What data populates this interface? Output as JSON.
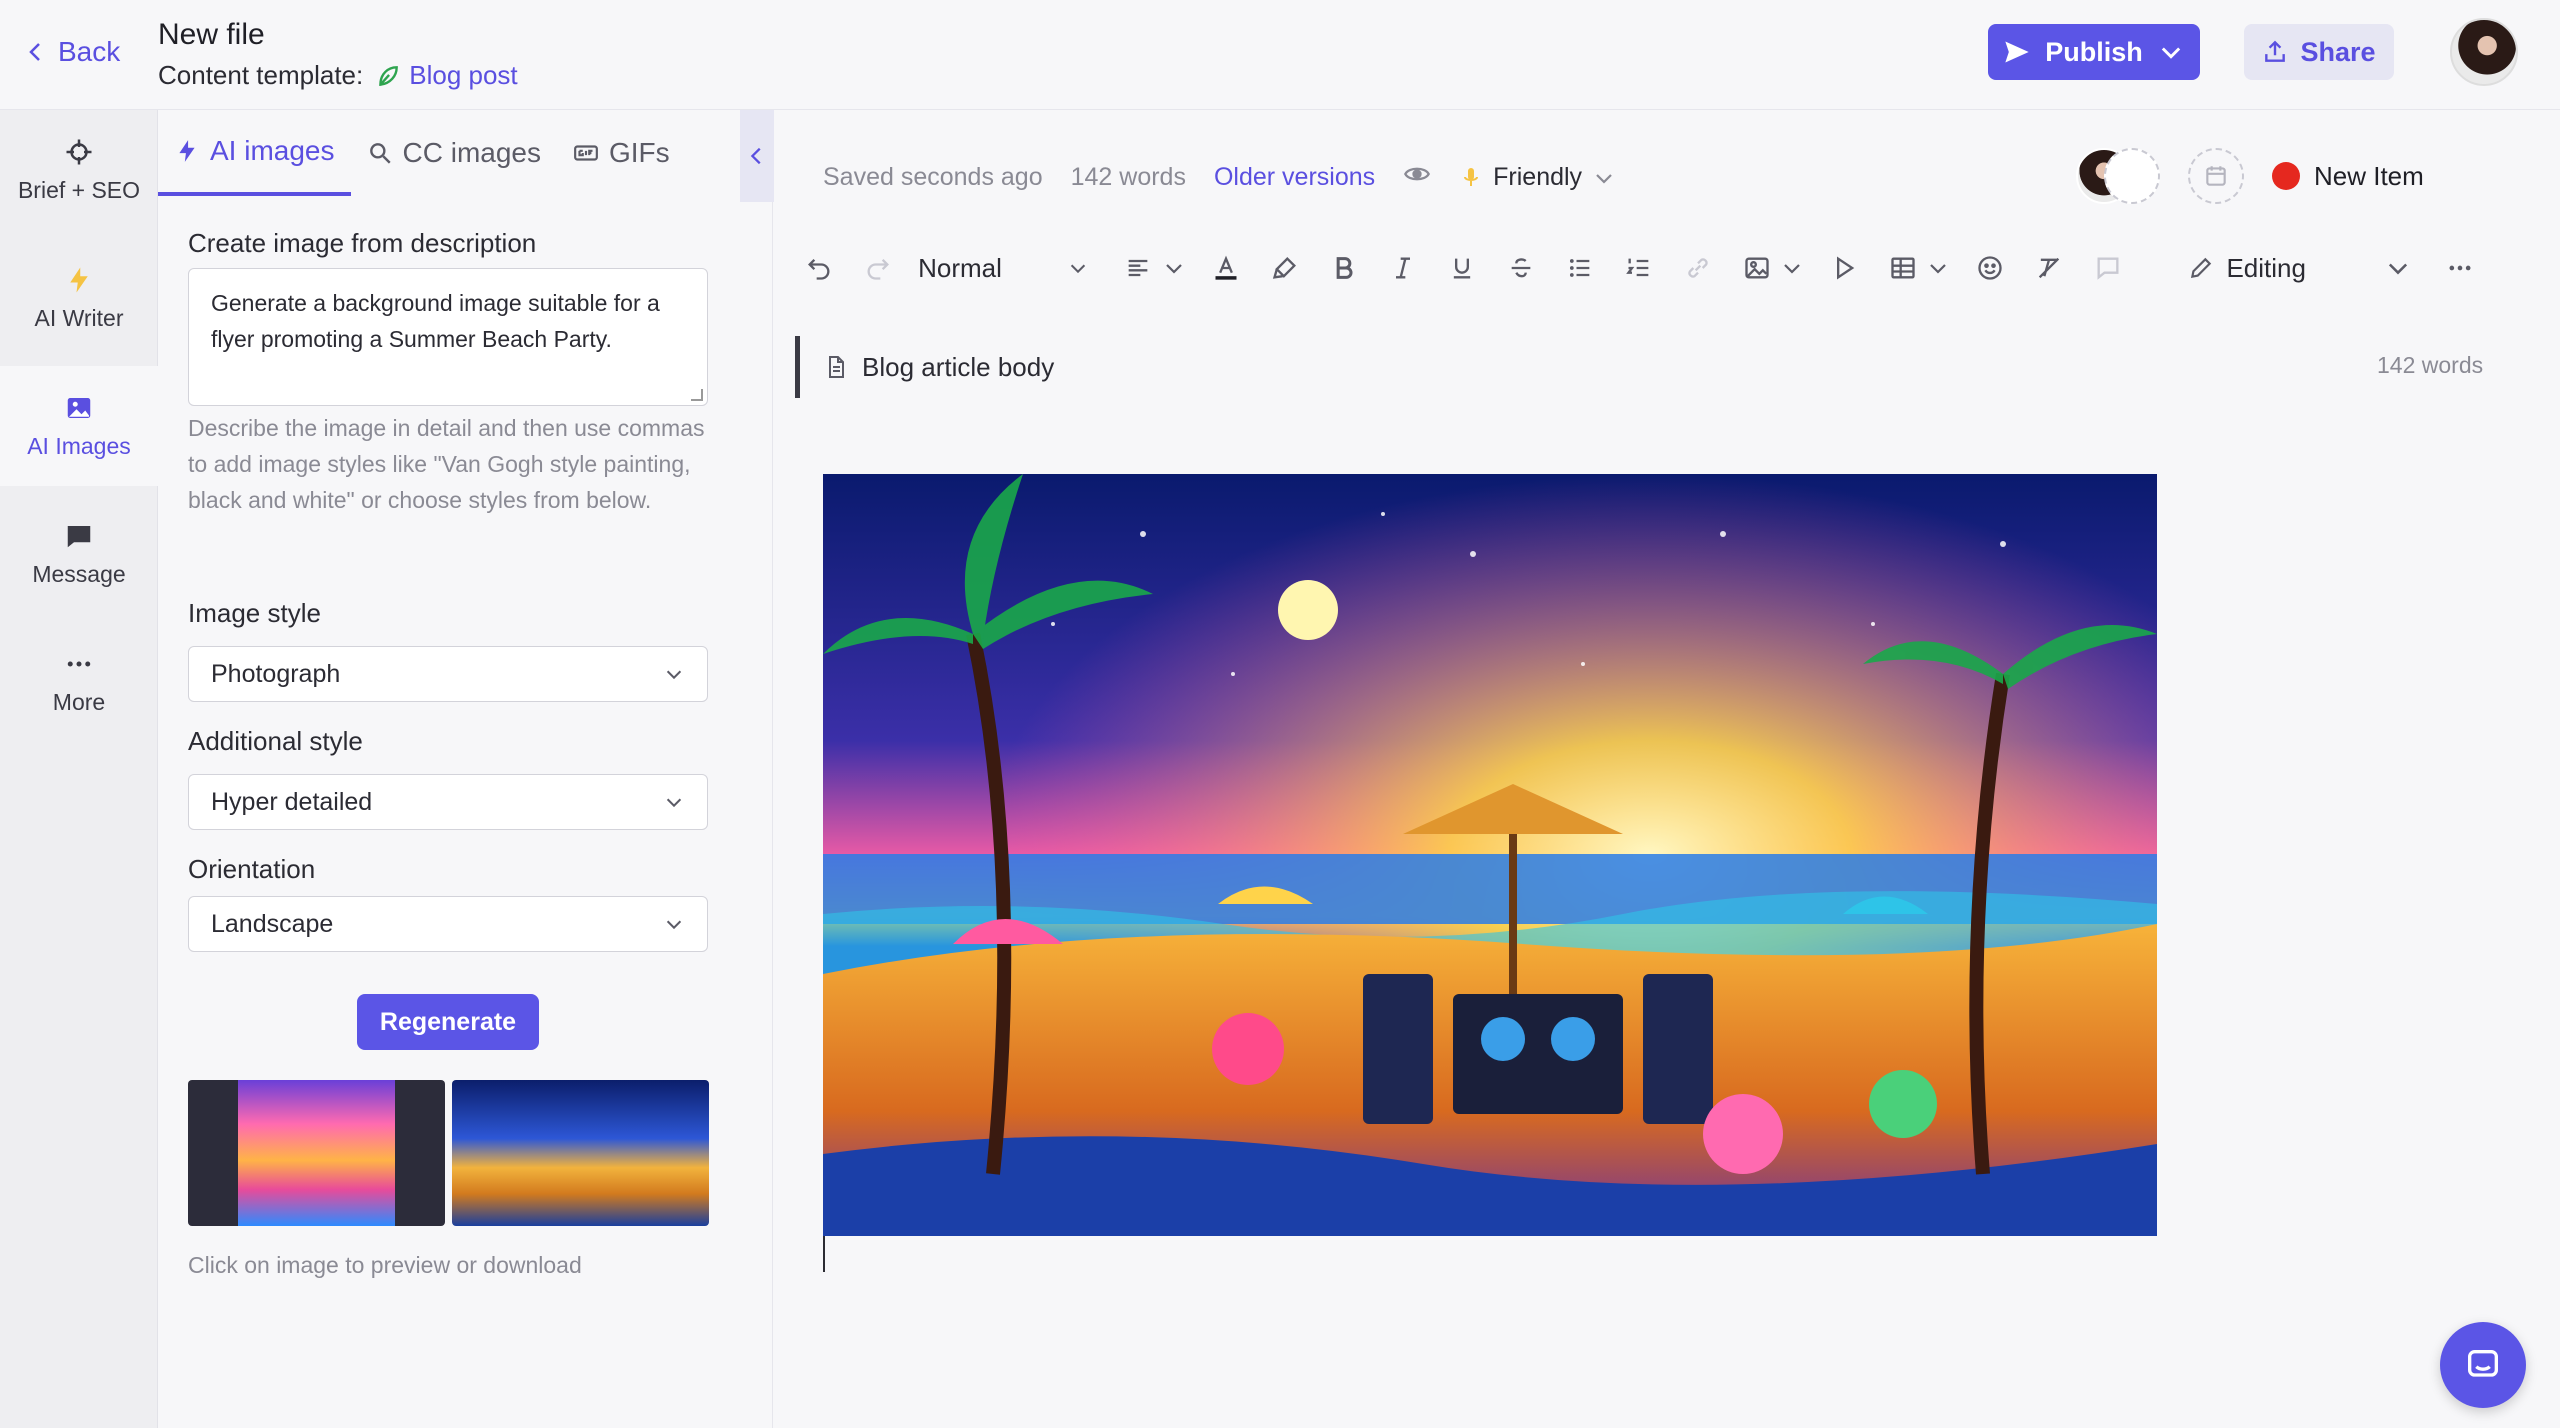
{
  "header": {
    "back_label": "Back",
    "file_title": "New file",
    "template_prefix": "Content template:",
    "template_name": "Blog post",
    "publish_label": "Publish",
    "share_label": "Share"
  },
  "rail": {
    "items": [
      {
        "label": "Brief + SEO",
        "icon": "crosshair-icon"
      },
      {
        "label": "AI Writer",
        "icon": "lightning-icon"
      },
      {
        "label": "AI Images",
        "icon": "image-icon"
      },
      {
        "label": "Message",
        "icon": "chat-icon"
      },
      {
        "label": "More",
        "icon": "ellipsis-icon"
      }
    ]
  },
  "panel": {
    "tabs": [
      {
        "label": "AI images",
        "icon": "lightning-icon"
      },
      {
        "label": "CC images",
        "icon": "search-icon"
      },
      {
        "label": "GIFs",
        "icon": "gif-icon"
      }
    ],
    "create_label": "Create image from description",
    "description_value": "Generate a background image suitable for a flyer promoting a Summer Beach Party.",
    "help_text": "Describe the image in detail and then use commas to add image styles like \"Van Gogh style painting, black and white\" or choose styles from below.",
    "image_style_label": "Image style",
    "image_style_value": "Photograph",
    "additional_style_label": "Additional style",
    "additional_style_value": "Hyper detailed",
    "orientation_label": "Orientation",
    "orientation_value": "Landscape",
    "regenerate_label": "Regenerate",
    "caption": "Click on image to preview or download"
  },
  "editor": {
    "saved_status": "Saved seconds ago",
    "word_count": "142 words",
    "older_versions": "Older versions",
    "tone": "Friendly",
    "new_item": "New Item",
    "paragraph_style": "Normal",
    "mode": "Editing",
    "section_title": "Blog article body",
    "section_word_count": "142 words"
  },
  "colors": {
    "accent": "#5b55e6",
    "status_red": "#e5281f",
    "template_green": "#2ea44f"
  }
}
